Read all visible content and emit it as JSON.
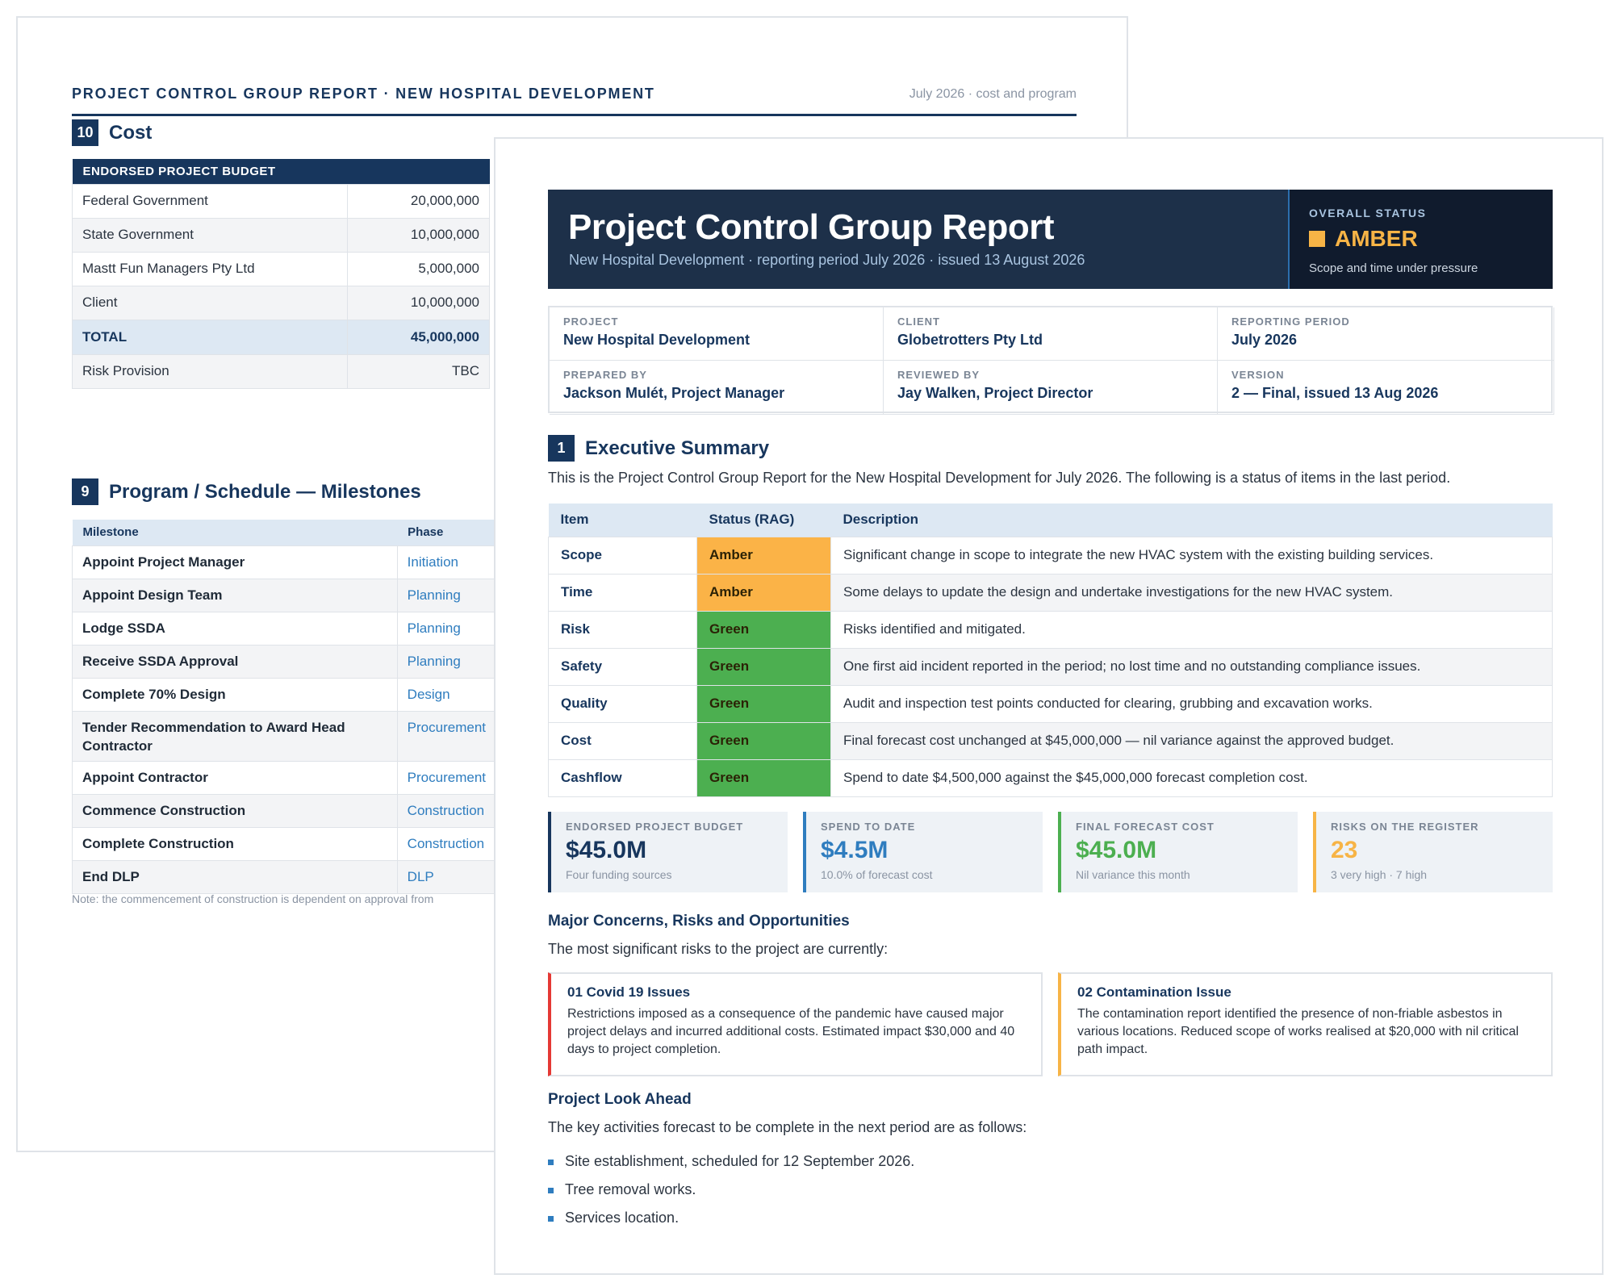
{
  "back_page": {
    "header_title": "PROJECT CONTROL GROUP REPORT · NEW HOSPITAL DEVELOPMENT",
    "header_meta": "July 2026 · cost and program",
    "cost": {
      "number": "10",
      "title": "Cost",
      "table_header": "ENDORSED PROJECT BUDGET",
      "rows": [
        {
          "label": "Federal Government",
          "value": "20,000,000"
        },
        {
          "label": "State Government",
          "value": "10,000,000"
        },
        {
          "label": "Mastt Fun Managers Pty Ltd",
          "value": "5,000,000"
        },
        {
          "label": "Client",
          "value": "10,000,000"
        },
        {
          "label": "TOTAL",
          "value": "45,000,000"
        },
        {
          "label": "Risk Provision",
          "value": "TBC"
        }
      ]
    },
    "program": {
      "number": "9",
      "title": "Program / Schedule — Milestones",
      "col_milestone": "Milestone",
      "col_phase": "Phase",
      "rows": [
        {
          "milestone": "Appoint Project Manager",
          "phase": "Initiation"
        },
        {
          "milestone": "Appoint Design Team",
          "phase": "Planning"
        },
        {
          "milestone": "Lodge SSDA",
          "phase": "Planning"
        },
        {
          "milestone": "Receive SSDA Approval",
          "phase": "Planning"
        },
        {
          "milestone": "Complete 70% Design",
          "phase": "Design"
        },
        {
          "milestone": "Tender Recommendation to Award Head Contractor",
          "phase": "Procurement"
        },
        {
          "milestone": "Appoint Contractor",
          "phase": "Procurement"
        },
        {
          "milestone": "Commence Construction",
          "phase": "Construction"
        },
        {
          "milestone": "Complete Construction",
          "phase": "Construction"
        },
        {
          "milestone": "End DLP",
          "phase": "DLP"
        }
      ],
      "note": "Note: the commencement of construction is dependent on approval from"
    }
  },
  "front_page": {
    "title": "Project Control Group Report",
    "subtitle": "New Hospital Development · reporting period July 2026 · issued 13 August 2026",
    "status": {
      "label": "OVERALL STATUS",
      "value": "AMBER",
      "note": "Scope and time under pressure",
      "color": "#f7b446"
    },
    "meta": [
      {
        "label": "PROJECT",
        "value": "New Hospital Development"
      },
      {
        "label": "CLIENT",
        "value": "Globetrotters Pty Ltd"
      },
      {
        "label": "REPORTING PERIOD",
        "value": "July 2026"
      },
      {
        "label": "PREPARED BY",
        "value": "Jackson Mulét, Project Manager"
      },
      {
        "label": "REVIEWED BY",
        "value": "Jay Walken, Project Director"
      },
      {
        "label": "VERSION",
        "value": "2 — Final, issued 13 Aug 2026"
      }
    ],
    "exec": {
      "number": "1",
      "title": "Executive Summary",
      "intro": "This is the Project Control Group Report for the New Hospital Development for July 2026. The following is a status of items in the last period.",
      "col_item": "Item",
      "col_status": "Status (RAG)",
      "col_desc": "Description",
      "rows": [
        {
          "item": "Scope",
          "status": "Amber",
          "color": "#fbb347",
          "desc": "Significant change in scope to integrate the new HVAC system with the existing building services."
        },
        {
          "item": "Time",
          "status": "Amber",
          "color": "#fbb347",
          "desc": "Some delays to update the design and undertake investigations for the new HVAC system."
        },
        {
          "item": "Risk",
          "status": "Green",
          "color": "#4caf50",
          "desc": "Risks identified and mitigated."
        },
        {
          "item": "Safety",
          "status": "Green",
          "color": "#4caf50",
          "desc": "One first aid incident reported in the period; no lost time and no outstanding compliance issues."
        },
        {
          "item": "Quality",
          "status": "Green",
          "color": "#4caf50",
          "desc": "Audit and inspection test points conducted for clearing, grubbing and excavation works."
        },
        {
          "item": "Cost",
          "status": "Green",
          "color": "#4caf50",
          "desc": "Final forecast cost unchanged at $45,000,000 — nil variance against the approved budget."
        },
        {
          "item": "Cashflow",
          "status": "Green",
          "color": "#4caf50",
          "desc": "Spend to date $4,500,000 against the $45,000,000 forecast completion cost."
        }
      ]
    },
    "kpis": [
      {
        "label": "ENDORSED PROJECT BUDGET",
        "value": "$45.0M",
        "note": "Four funding sources",
        "color": "#17365d"
      },
      {
        "label": "SPEND TO DATE",
        "value": "$4.5M",
        "note": "10.0% of forecast cost",
        "color": "#2f7dbf"
      },
      {
        "label": "FINAL FORECAST COST",
        "value": "$45.0M",
        "note": "Nil variance this month",
        "color": "#4caf50"
      },
      {
        "label": "RISKS ON THE REGISTER",
        "value": "23",
        "note": "3 very high · 7 high",
        "color": "#f7b446"
      }
    ],
    "risks": {
      "title": "Major Concerns, Risks and Opportunities",
      "intro": "The most significant risks to the project are currently:",
      "cards": [
        {
          "title": "01 Covid 19 Issues",
          "text": "Restrictions imposed as a consequence of the pandemic have caused major project delays and incurred additional costs. Estimated impact $30,000 and 40 days to project completion.",
          "color": "#e53935"
        },
        {
          "title": "02 Contamination Issue",
          "text": "The contamination report identified the presence of non-friable asbestos in various locations. Reduced scope of works realised at $20,000 with nil critical path impact.",
          "color": "#f7b446"
        }
      ]
    },
    "look_ahead": {
      "title": "Project Look Ahead",
      "intro": "The key activities forecast to be complete in the next period are as follows:",
      "items": [
        "Site establishment, scheduled for 12 September 2026.",
        "Tree removal works.",
        "Services location."
      ]
    }
  }
}
